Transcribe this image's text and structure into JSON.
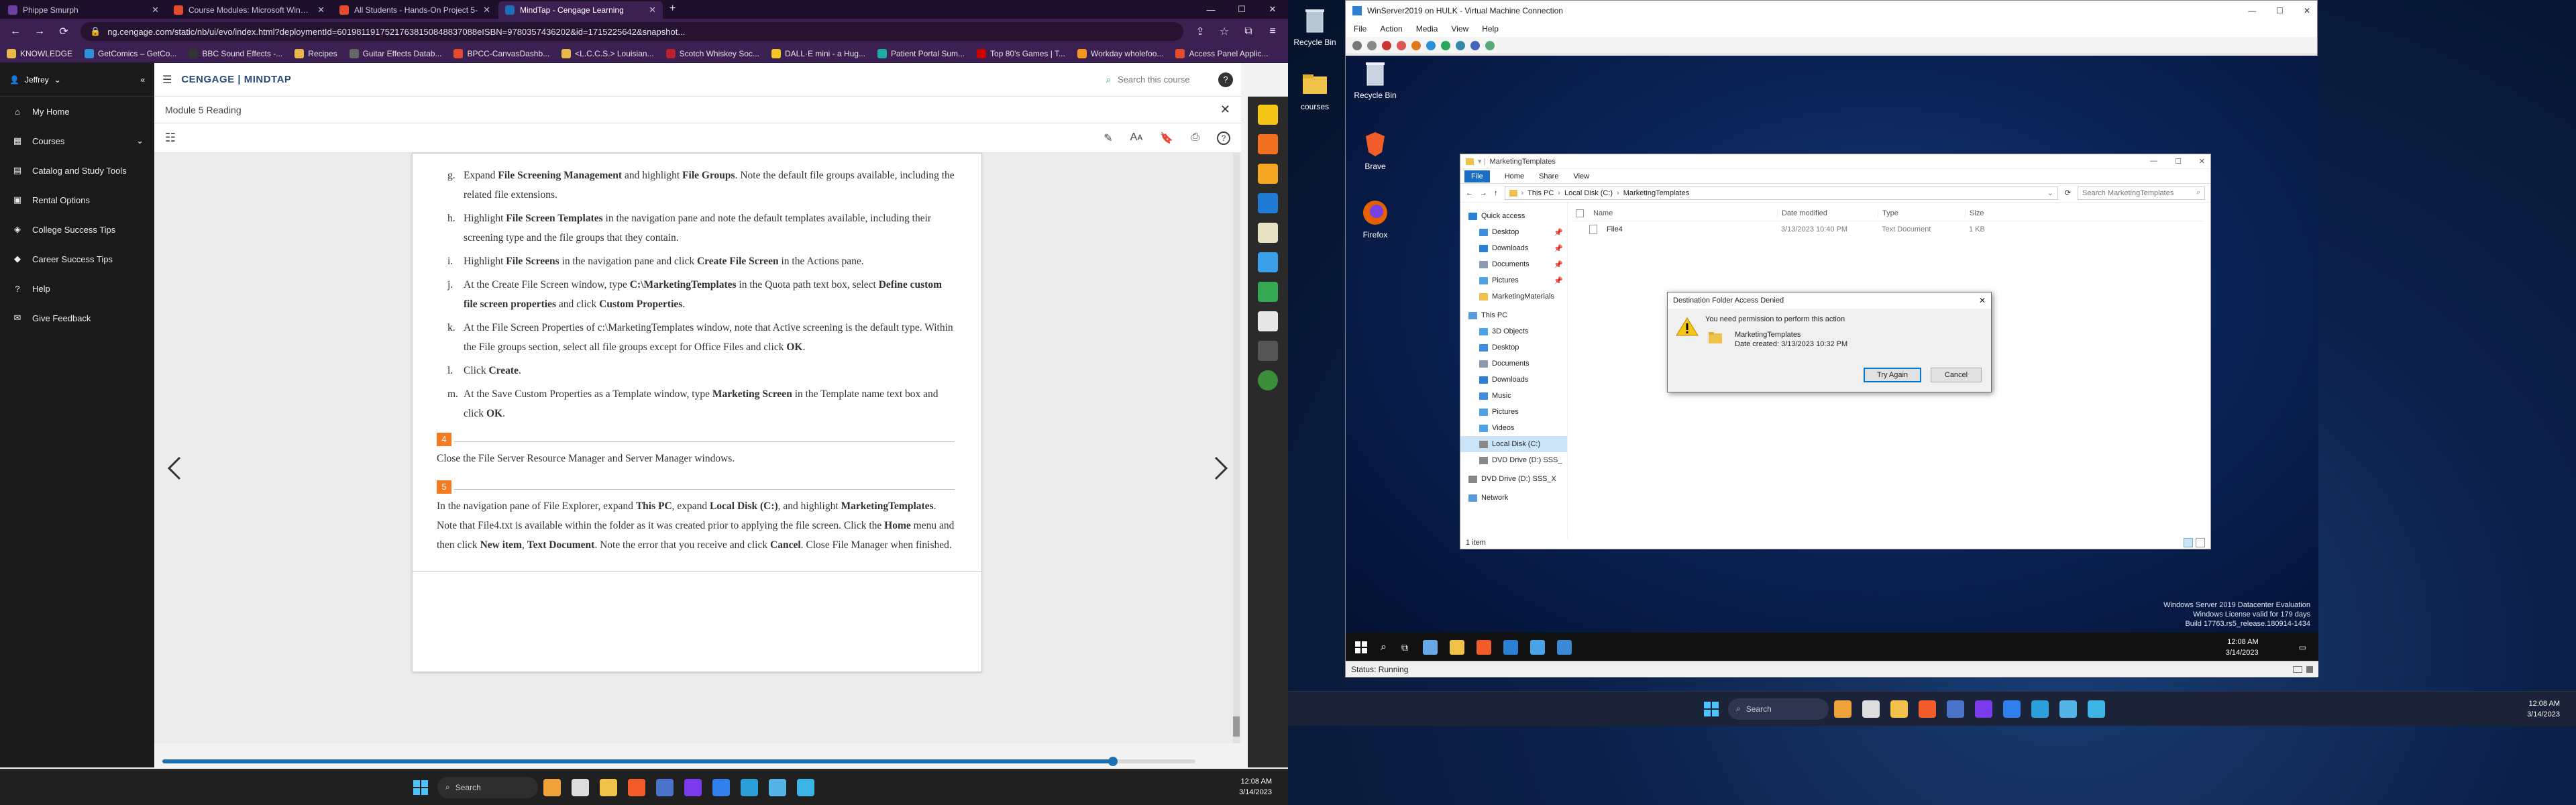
{
  "browser": {
    "tabs": [
      {
        "title": "Phippe Smurph",
        "fav": "#6b3fa0"
      },
      {
        "title": "Course Modules: Microsoft Windows",
        "fav": "#e54b2d"
      },
      {
        "title": "All Students - Hands-On Project 5-",
        "fav": "#e54b2d"
      },
      {
        "title": "MindTap - Cengage Learning",
        "fav": "#1a6fb5"
      }
    ],
    "address": "ng.cengage.com/static/nb/ui/evo/index.html?deploymentId=60198119175217638150848837088eISBN=9780357436202&id=1715225642&snapshot...",
    "bookmarks": [
      {
        "label": "KNOWLEDGE",
        "color": "#e8b84a"
      },
      {
        "label": "GetComics – GetCo...",
        "color": "#2f8fd6"
      },
      {
        "label": "BBC Sound Effects -...",
        "color": "#333"
      },
      {
        "label": "Recipes",
        "color": "#e8b84a"
      },
      {
        "label": "Guitar Effects Datab...",
        "color": "#666"
      },
      {
        "label": "BPCC-CanvasDashb...",
        "color": "#e54b2d"
      },
      {
        "label": "<L.C.C.S.> Louisian...",
        "color": "#e8b84a"
      },
      {
        "label": "Scotch Whiskey Soc...",
        "color": "#b23"
      },
      {
        "label": "DALL·E mini - a Hug...",
        "color": "#f3c623"
      },
      {
        "label": "Patient Portal Sum...",
        "color": "#2aa"
      },
      {
        "label": "Top 80's Games | T...",
        "color": "#c00"
      },
      {
        "label": "Workday wholefoo...",
        "color": "#f39a1e"
      },
      {
        "label": "Access Panel Applic...",
        "color": "#e54b2d"
      }
    ]
  },
  "sidebar": {
    "user": "Jeffrey",
    "items": [
      {
        "label": "My Home",
        "icon": "home-icon"
      },
      {
        "label": "Courses",
        "icon": "courses-icon"
      },
      {
        "label": "Catalog and Study Tools",
        "icon": "catalog-icon"
      },
      {
        "label": "Rental Options",
        "icon": "rental-icon"
      },
      {
        "label": "College Success Tips",
        "icon": "tips-icon"
      },
      {
        "label": "Career Success Tips",
        "icon": "career-icon"
      },
      {
        "label": "Help",
        "icon": "help-icon"
      },
      {
        "label": "Give Feedback",
        "icon": "feedback-icon"
      }
    ]
  },
  "mindtap": {
    "logo": "CENGAGE | MINDTAP",
    "search_placeholder": "Search this course",
    "module_title": "Module 5 Reading"
  },
  "reading": {
    "steps": [
      {
        "letter": "g.",
        "html": "Expand <b>File Screening Management</b> and highlight <b>File Groups</b>. Note the default file groups available, including the related file extensions."
      },
      {
        "letter": "h.",
        "html": "Highlight <b>File Screen Templates</b> in the navigation pane and note the default templates available, including their screening type and the file groups that they contain."
      },
      {
        "letter": "i.",
        "html": "Highlight <b>File Screens</b> in the navigation pane and click <b>Create File Screen</b> in the Actions pane."
      },
      {
        "letter": "j.",
        "html": "At the Create File Screen window, type <b>C:\\MarketingTemplates</b> in the Quota path text box, select <b>Define custom file screen properties</b> and click <b>Custom Properties</b>."
      },
      {
        "letter": "k.",
        "html": "At the File Screen Properties of c:\\MarketingTemplates window, note that Active screening is the default type. Within the File groups section, select all file groups except for Office Files and click <b>OK</b>."
      },
      {
        "letter": "l.",
        "html": "Click <b>Create</b>."
      },
      {
        "letter": "m.",
        "html": "At the Save Custom Properties as a Template window, type <b>Marketing Screen</b> in the Template name text box and click <b>OK</b>."
      }
    ],
    "step4_num": "4",
    "step4_text": "Close the File Server Resource Manager and Server Manager windows.",
    "step5_num": "5",
    "step5_html": "In the navigation pane of File Explorer, expand <b>This PC</b>, expand <b>Local Disk (C:)</b>, and highlight <b>MarketingTemplates</b>. Note that File4.txt is available within the folder as it was created prior to applying the file screen. Click the <b>Home</b> menu and then click <b>New item</b>, <b>Text Document</b>. Note the error that you receive and click <b>Cancel</b>. Close File Manager when finished.",
    "progress": 0.92
  },
  "taskbar_left": {
    "search": "Search",
    "time": "12:08 AM",
    "date": "3/14/2023"
  },
  "desktop_right": {
    "icons": [
      {
        "label": "Recycle Bin"
      },
      {
        "label": "courses"
      }
    ],
    "time": "12:08 AM",
    "date": "3/14/2023",
    "search": "Search"
  },
  "vm": {
    "title": "WinServer2019 on HULK - Virtual Machine Connection",
    "menu": [
      "File",
      "Action",
      "Media",
      "View",
      "Help"
    ],
    "status": "Status: Running",
    "desktop_icons": [
      {
        "label": "Recycle Bin"
      },
      {
        "label": "Brave"
      },
      {
        "label": "Firefox"
      }
    ],
    "watermark": [
      "Windows Server 2019 Datacenter Evaluation",
      "Windows License valid for 179 days",
      "Build 17763.rs5_release.180914-1434"
    ],
    "time": "12:08 AM",
    "date": "3/14/2023"
  },
  "explorer": {
    "title": "MarketingTemplates",
    "ribbon": [
      "File",
      "Home",
      "Share",
      "View"
    ],
    "path": [
      "This PC",
      "Local Disk (C:)",
      "MarketingTemplates"
    ],
    "search_placeholder": "Search MarketingTemplates",
    "nav": [
      {
        "label": "Quick access",
        "top": true,
        "color": "#2b7fd4"
      },
      {
        "label": "Desktop",
        "color": "#3d8ee0"
      },
      {
        "label": "Downloads",
        "color": "#2b7fd4"
      },
      {
        "label": "Documents",
        "color": "#8a9bb0"
      },
      {
        "label": "Pictures",
        "color": "#4da3e6"
      },
      {
        "label": "MarketingMaterials",
        "color": "#f0c24a"
      },
      {
        "label": "This PC",
        "top": true,
        "color": "#5a9bd8"
      },
      {
        "label": "3D Objects",
        "color": "#4da3e6"
      },
      {
        "label": "Desktop",
        "color": "#3d8ee0"
      },
      {
        "label": "Documents",
        "color": "#8a9bb0"
      },
      {
        "label": "Downloads",
        "color": "#2b7fd4"
      },
      {
        "label": "Music",
        "color": "#3d8ee0"
      },
      {
        "label": "Pictures",
        "color": "#4da3e6"
      },
      {
        "label": "Videos",
        "color": "#4da3e6"
      },
      {
        "label": "Local Disk (C:)",
        "color": "#888",
        "selected": true
      },
      {
        "label": "DVD Drive (D:) SSS_",
        "color": "#888"
      },
      {
        "label": "DVD Drive (D:) SSS_X",
        "color": "#888",
        "top": true
      },
      {
        "label": "Network",
        "top": true,
        "color": "#5a9bd8"
      }
    ],
    "columns": [
      "Name",
      "Date modified",
      "Type",
      "Size"
    ],
    "files": [
      {
        "name": "File4",
        "date": "3/13/2023 10:40 PM",
        "type": "Text Document",
        "size": "1 KB"
      }
    ],
    "item_count": "1 item"
  },
  "dialog": {
    "title": "Destination Folder Access Denied",
    "message": "You need permission to perform this action",
    "folder_name": "MarketingTemplates",
    "folder_date": "Date created: 3/13/2023 10:32 PM",
    "try_again": "Try Again",
    "cancel": "Cancel"
  }
}
